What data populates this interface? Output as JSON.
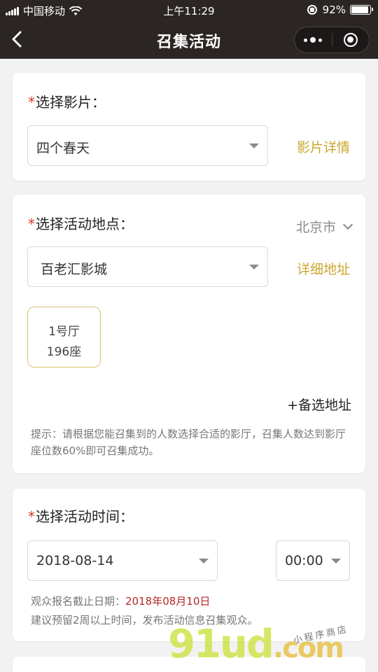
{
  "status_bar": {
    "carrier": "中国移动",
    "time": "上午11:29",
    "battery_text": "92%",
    "battery_level": 0.92
  },
  "nav": {
    "title": "召集活动",
    "back_icon": "chevron-left-icon",
    "more_icon": "more-dots-icon",
    "close_icon": "target-icon"
  },
  "film": {
    "required_mark": "*",
    "label": "选择影片：",
    "selected": "四个春天",
    "detail_link": "影片详情"
  },
  "venue": {
    "required_mark": "*",
    "label": "选择活动地点：",
    "city": "北京市",
    "selected": "百老汇影城",
    "detail_link": "详细地址",
    "hall": {
      "name": "1号厅",
      "seats": "196座"
    },
    "add_alternative": "+备选地址",
    "tip": "提示：请根据您能召集到的人数选择合适的影厅，召集人数达到影厅座位数60%即可召集成功。"
  },
  "time": {
    "required_mark": "*",
    "label": "选择活动时间：",
    "date": "2018-08-14",
    "clock": "00:00",
    "deadline_label": "观众报名截止日期：",
    "deadline_date": "2018年08月10日",
    "advice": "建议预留2周以上时间，发布活动信息召集观众。"
  },
  "watermark": {
    "brand": "91ud",
    "suffix": ".com",
    "sub": "小程序商店"
  },
  "colors": {
    "nav_bg": "#2b2624",
    "accent": "#c9a72f",
    "required": "#d43c2c",
    "deadline": "#b5292a"
  }
}
